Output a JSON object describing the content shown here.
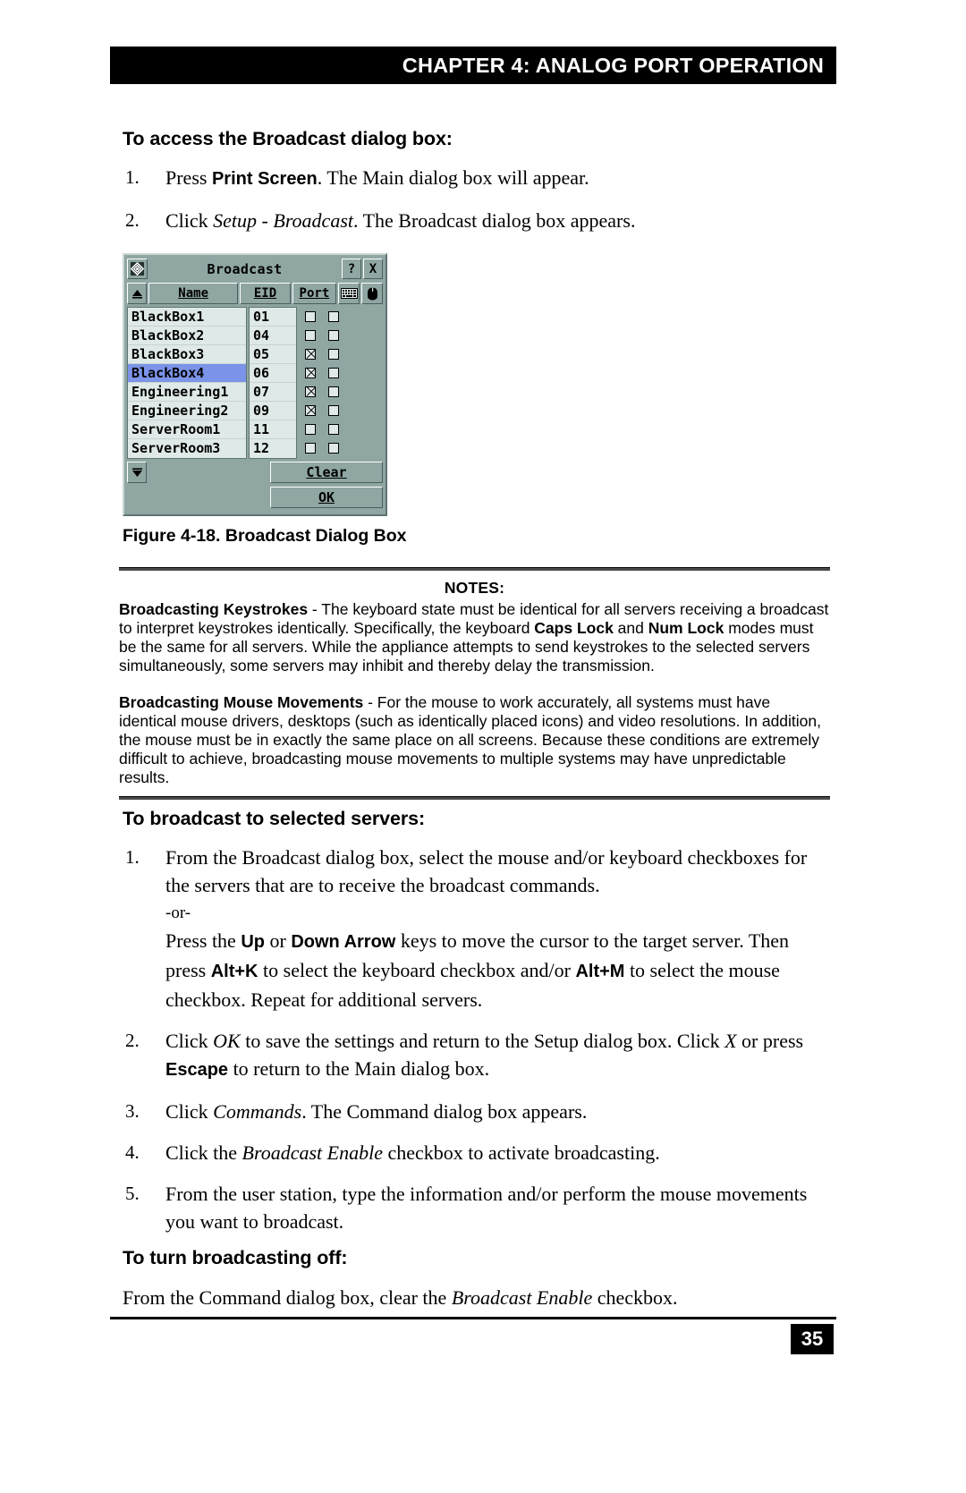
{
  "header": {
    "chapter_title": "CHAPTER 4: ANALOG PORT OPERATION"
  },
  "section1": {
    "heading": "To access the Broadcast dialog box:",
    "steps": [
      {
        "num": "1.",
        "parts": [
          {
            "t": "Press ",
            "s": "normal"
          },
          {
            "t": "Print Screen",
            "s": "bold-sans"
          },
          {
            "t": ". The Main dialog box will appear.",
            "s": "normal"
          }
        ]
      },
      {
        "num": "2.",
        "parts": [
          {
            "t": "Click ",
            "s": "normal"
          },
          {
            "t": "Setup - Broadcast",
            "s": "italic"
          },
          {
            "t": ". The Broadcast dialog box appears.",
            "s": "normal"
          }
        ]
      }
    ]
  },
  "dialog": {
    "title": "Broadcast",
    "system_icon": "system-menu-icon",
    "help_button": "?",
    "close_button": "X",
    "scroll_up": "▲",
    "scroll_down": "▼",
    "columns": [
      {
        "label": "Name",
        "accel": "N"
      },
      {
        "label": "EID",
        "accel": "E"
      },
      {
        "label": "Port",
        "accel": "P"
      }
    ],
    "keyboard_column_icon": "keyboard-icon",
    "mouse_column_icon": "mouse-icon",
    "rows": [
      {
        "name": "BlackBox1",
        "port": "01",
        "keyboard": false,
        "mouse": false,
        "selected": false
      },
      {
        "name": "BlackBox2",
        "port": "04",
        "keyboard": false,
        "mouse": false,
        "selected": false
      },
      {
        "name": "BlackBox3",
        "port": "05",
        "keyboard": true,
        "mouse": false,
        "selected": false
      },
      {
        "name": "BlackBox4",
        "port": "06",
        "keyboard": true,
        "mouse": false,
        "selected": true
      },
      {
        "name": "Engineering1",
        "port": "07",
        "keyboard": true,
        "mouse": false,
        "selected": false
      },
      {
        "name": "Engineering2",
        "port": "09",
        "keyboard": true,
        "mouse": false,
        "selected": false
      },
      {
        "name": "ServerRoom1",
        "port": "11",
        "keyboard": false,
        "mouse": false,
        "selected": false
      },
      {
        "name": "ServerRoom3",
        "port": "12",
        "keyboard": false,
        "mouse": false,
        "selected": false
      }
    ],
    "clear_button": "Clear",
    "clear_accel": "C",
    "ok_button": "OK",
    "ok_accel": "O",
    "selection_color": "#7b93e8",
    "chrome_color": "#8fa6a3"
  },
  "figure": {
    "caption": "Figure 4-18. Broadcast Dialog Box"
  },
  "notes": {
    "title": "NOTES:",
    "paragraphs": [
      {
        "parts": [
          {
            "t": "Broadcasting Keystrokes",
            "s": "bold"
          },
          {
            "t": " - The keyboard state must be identical for all servers receiving a broadcast to interpret keystrokes identically. Specifically, the keyboard ",
            "s": "normal"
          },
          {
            "t": "Caps Lock",
            "s": "bold"
          },
          {
            "t": " and ",
            "s": "normal"
          },
          {
            "t": "Num Lock",
            "s": "bold"
          },
          {
            "t": " modes must be the same for all servers. While the appliance attempts to send keystrokes to the selected servers simultaneously, some servers may inhibit and thereby delay the transmission.",
            "s": "normal"
          }
        ]
      },
      {
        "parts": [
          {
            "t": "Broadcasting Mouse Movements",
            "s": "bold"
          },
          {
            "t": " - For the mouse to work accurately, all systems must have identical mouse drivers, desktops (such as identically placed icons) and video resolutions. In addition, the mouse must be in exactly the same place on all screens. Because these conditions are extremely difficult to achieve, broadcasting mouse movements to multiple systems may have unpredictable results.",
            "s": "normal"
          }
        ]
      }
    ]
  },
  "section2": {
    "heading": "To broadcast to selected servers:",
    "steps": [
      {
        "num": "1.",
        "lines": [
          {
            "parts": [
              {
                "t": "From the Broadcast dialog box, select the mouse and/or keyboard checkboxes for the servers that are to receive the broadcast commands.",
                "s": "normal"
              }
            ]
          },
          {
            "or": true,
            "parts": [
              {
                "t": "-or-",
                "s": "normal"
              }
            ]
          },
          {
            "parts": [
              {
                "t": "Press the ",
                "s": "normal"
              },
              {
                "t": "Up",
                "s": "bold-sans"
              },
              {
                "t": " or ",
                "s": "normal"
              },
              {
                "t": "Down Arrow",
                "s": "bold-sans"
              },
              {
                "t": " keys to move the cursor to the target server. Then press ",
                "s": "normal"
              },
              {
                "t": "Alt+K",
                "s": "bold-sans"
              },
              {
                "t": " to select the keyboard checkbox and/or ",
                "s": "normal"
              },
              {
                "t": "Alt+M",
                "s": "bold-sans"
              },
              {
                "t": " to select the mouse checkbox. Repeat for additional servers.",
                "s": "normal"
              }
            ]
          }
        ]
      },
      {
        "num": "2.",
        "lines": [
          {
            "parts": [
              {
                "t": "Click ",
                "s": "normal"
              },
              {
                "t": "OK",
                "s": "italic"
              },
              {
                "t": " to save the settings and return to the Setup dialog box. Click ",
                "s": "normal"
              },
              {
                "t": "X",
                "s": "italic"
              },
              {
                "t": " or press ",
                "s": "normal"
              },
              {
                "t": "Escape",
                "s": "bold-sans"
              },
              {
                "t": " to return to the Main dialog box.",
                "s": "normal"
              }
            ]
          }
        ]
      },
      {
        "num": "3.",
        "lines": [
          {
            "parts": [
              {
                "t": "Click ",
                "s": "normal"
              },
              {
                "t": "Commands",
                "s": "italic"
              },
              {
                "t": ". The Command dialog box appears.",
                "s": "normal"
              }
            ]
          }
        ]
      },
      {
        "num": "4.",
        "lines": [
          {
            "parts": [
              {
                "t": "Click the ",
                "s": "normal"
              },
              {
                "t": "Broadcast Enable",
                "s": "italic"
              },
              {
                "t": " checkbox to activate broadcasting.",
                "s": "normal"
              }
            ]
          }
        ]
      },
      {
        "num": "5.",
        "lines": [
          {
            "parts": [
              {
                "t": "From the user station, type the information and/or perform the mouse movements you want to broadcast.",
                "s": "normal"
              }
            ]
          }
        ]
      }
    ]
  },
  "section3": {
    "heading": "To turn broadcasting off:",
    "body_parts": [
      {
        "t": "From the Command dialog box, clear the ",
        "s": "normal"
      },
      {
        "t": "Broadcast Enable",
        "s": "italic"
      },
      {
        "t": " checkbox.",
        "s": "normal"
      }
    ]
  },
  "footer": {
    "page_number": "35"
  }
}
